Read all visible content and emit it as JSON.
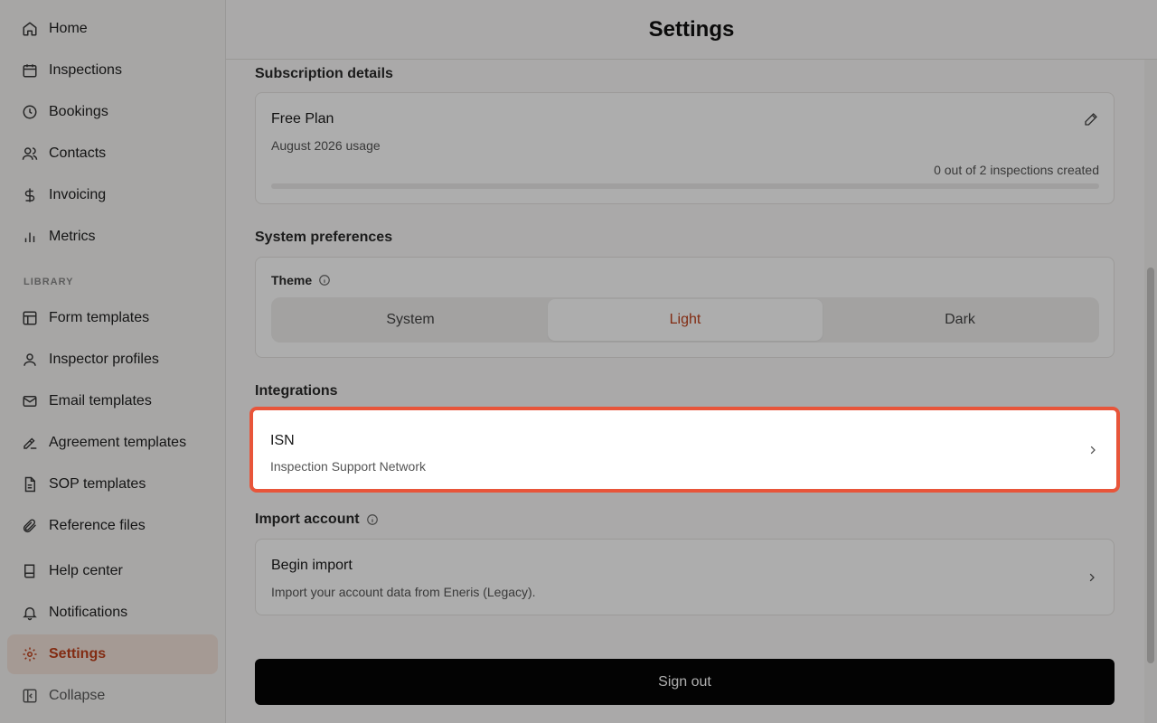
{
  "sidebar": {
    "items": [
      {
        "label": "Home",
        "icon": "home-icon"
      },
      {
        "label": "Inspections",
        "icon": "calendar-icon"
      },
      {
        "label": "Bookings",
        "icon": "clock-icon"
      },
      {
        "label": "Contacts",
        "icon": "users-icon"
      },
      {
        "label": "Invoicing",
        "icon": "dollar-icon"
      },
      {
        "label": "Metrics",
        "icon": "bar-chart-icon"
      }
    ],
    "library_label": "LIBRARY",
    "library_items": [
      {
        "label": "Form templates",
        "icon": "layout-icon"
      },
      {
        "label": "Inspector profiles",
        "icon": "user-icon"
      },
      {
        "label": "Email templates",
        "icon": "mail-icon"
      },
      {
        "label": "Agreement templates",
        "icon": "signature-icon"
      },
      {
        "label": "SOP templates",
        "icon": "file-text-icon"
      },
      {
        "label": "Reference files",
        "icon": "paperclip-icon"
      }
    ],
    "bottom_items": [
      {
        "label": "Help center",
        "icon": "book-icon"
      },
      {
        "label": "Notifications",
        "icon": "bell-icon"
      },
      {
        "label": "Settings",
        "icon": "gear-icon"
      },
      {
        "label": "Collapse",
        "icon": "collapse-icon"
      }
    ]
  },
  "header": {
    "title": "Settings"
  },
  "subscription": {
    "section_title": "Subscription details",
    "plan_name": "Free Plan",
    "usage_label": "August 2026 usage",
    "count_label": "0 out of 2 inspections created",
    "progress_fraction": 0
  },
  "preferences": {
    "section_title": "System preferences",
    "theme_label": "Theme",
    "options": [
      "System",
      "Light",
      "Dark"
    ],
    "selected": "Light"
  },
  "integrations": {
    "section_title": "Integrations",
    "isn_title": "ISN",
    "isn_subtitle": "Inspection Support Network"
  },
  "import": {
    "section_title": "Import account",
    "title": "Begin import",
    "subtitle": "Import your account data from Eneris (Legacy)."
  },
  "actions": {
    "sign_out": "Sign out"
  },
  "colors": {
    "accent": "#c0421c",
    "highlight_border": "#e8553a"
  }
}
